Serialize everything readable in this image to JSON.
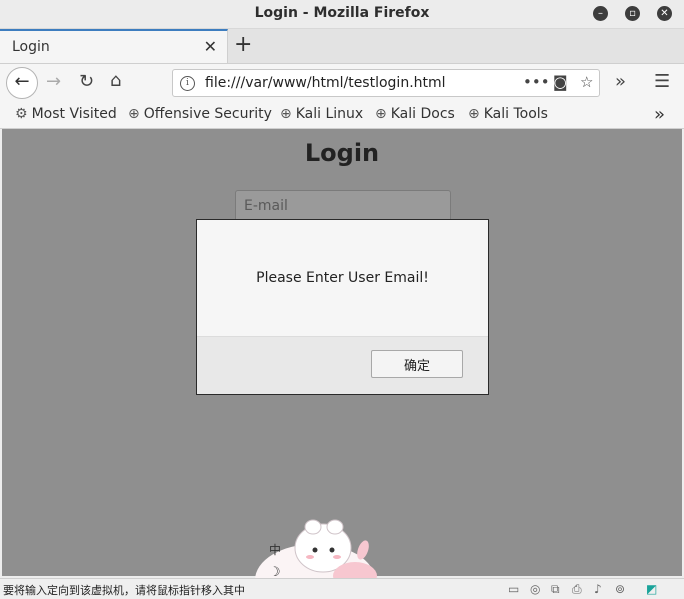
{
  "window": {
    "title": "Login - Mozilla Firefox"
  },
  "tab": {
    "label": "Login"
  },
  "address": {
    "url": "file:///var/www/html/testlogin.html"
  },
  "bookmarks": [
    {
      "label": "Most Visited",
      "icon": "gear-icon"
    },
    {
      "label": "Offensive Security",
      "icon": "globe-icon"
    },
    {
      "label": "Kali Linux",
      "icon": "globe-icon"
    },
    {
      "label": "Kali Docs",
      "icon": "globe-icon"
    },
    {
      "label": "Kali Tools",
      "icon": "globe-icon"
    }
  ],
  "page": {
    "title": "Login",
    "email_placeholder": "E-mail"
  },
  "dialog": {
    "message": "Please Enter User Email!",
    "ok_label": "确定"
  },
  "status": {
    "text": "要将输入定向到该虚拟机，请将鼠标指针移入其中"
  },
  "mascot": {
    "ime_label": "中"
  }
}
